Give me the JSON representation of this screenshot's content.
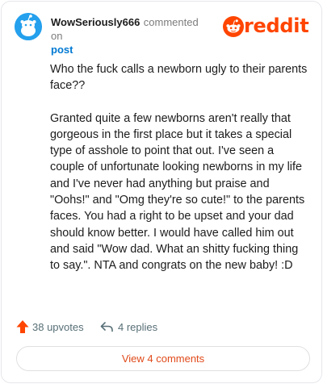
{
  "header": {
    "username": "WowSeriously666",
    "commented_on": "commented on",
    "post_link": "post",
    "brand": "reddit"
  },
  "comment": {
    "paragraphs": [
      "Who the fuck calls a newborn ugly to their parents face??",
      "Granted quite a few newborns aren't really that gorgeous in the first place but it takes a special type of asshole to point that out. I've seen a couple of unfortunate looking newborns in my life and I've never had anything but praise and \"Oohs!\" and \"Omg they're so cute!\" to the parents faces. You had a right to be upset and your dad should know better. I would have called him out and said \"Wow dad. What an shitty fucking thing to say.\". NTA and congrats on the new baby! :D"
    ]
  },
  "actions": {
    "upvotes_label": "38 upvotes",
    "replies_label": "4 replies"
  },
  "footer": {
    "view_comments_label": "View 4 comments"
  },
  "colors": {
    "brand": "#ff4500",
    "link": "#0079d3",
    "avatar_bg": "#24a0ed"
  },
  "icons": {
    "avatar": "snoo-avatar",
    "logo": "reddit-alien-icon",
    "upvote": "upvote-arrow-icon",
    "reply": "reply-arrow-icon"
  }
}
